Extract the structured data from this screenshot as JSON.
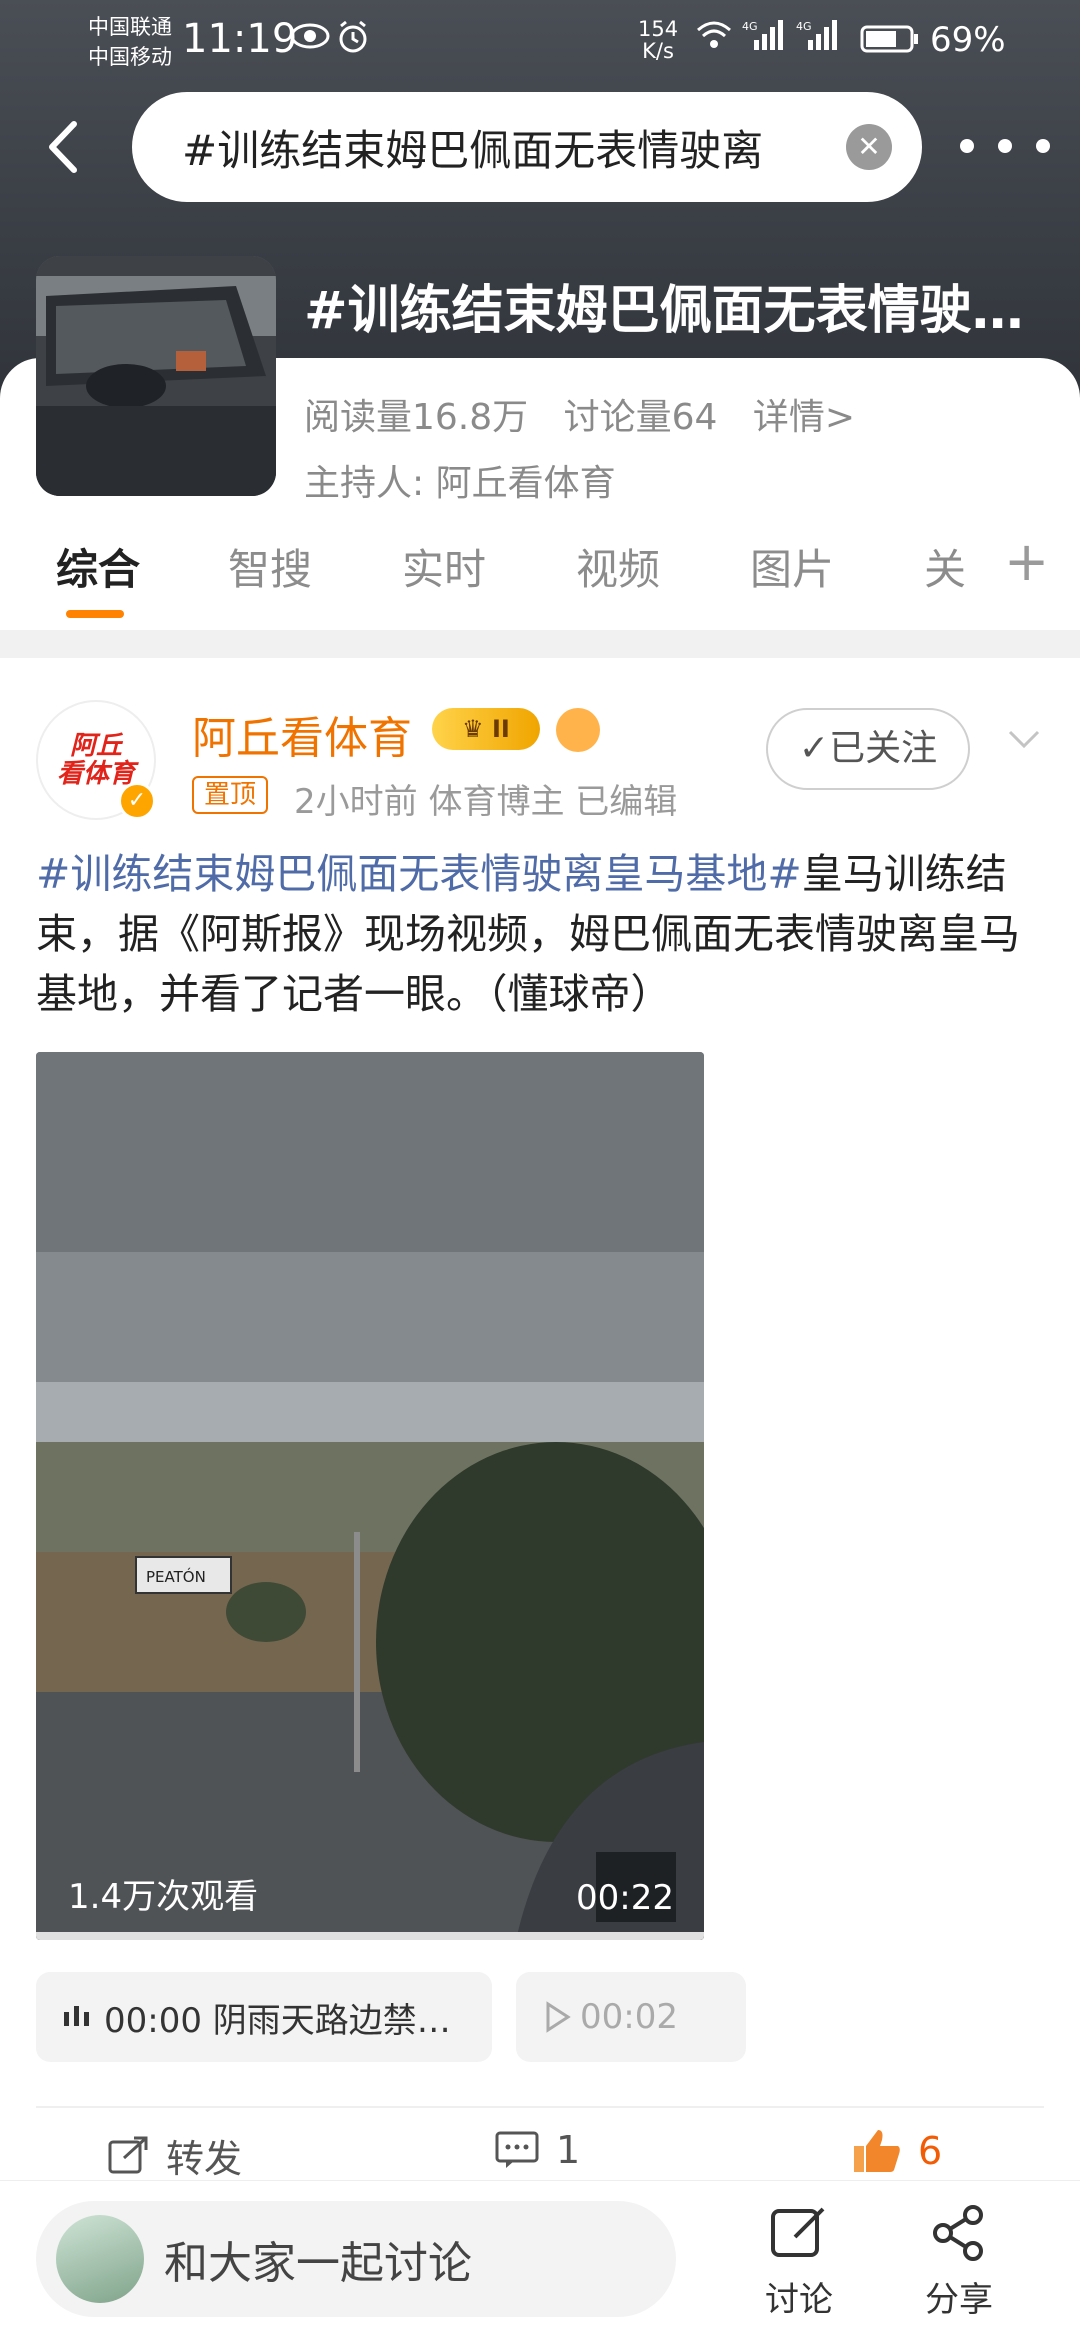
{
  "status_bar": {
    "carrier_1": "中国联通",
    "carrier_2": "中国移动",
    "time": "11:19",
    "net_speed_value": "154",
    "net_speed_unit": "K/s",
    "battery": "69%"
  },
  "search": {
    "query": "#训练结束姆巴佩面无表情驶离"
  },
  "topic": {
    "title": "#训练结束姆巴佩面无表情驶…",
    "reads": "阅读量16.8万",
    "discussions": "讨论量64",
    "details_link": "详情>",
    "host": "主持人: 阿丘看体育"
  },
  "tabs": [
    {
      "label": "综合"
    },
    {
      "label": "智搜"
    },
    {
      "label": "实时"
    },
    {
      "label": "视频"
    },
    {
      "label": "图片"
    },
    {
      "label": "关"
    }
  ],
  "post": {
    "avatar_logo_line1": "阿丘",
    "avatar_logo_line2": "看体育",
    "author": "阿丘看体育",
    "vip_level": "II",
    "pinned_label": "置顶",
    "meta": "2小时前   体育博主   已编辑",
    "follow_label": "✓已关注",
    "hashtag": "#训练结束姆巴佩面无表情驶离皇马基地#",
    "body": "皇马训练结束，据《阿斯报》现场视频，姆巴佩面无表情驶离皇马基地，并看了记者一眼。（懂球帝）",
    "video_views": "1.4万次观看",
    "video_duration": "00:22",
    "video_sign": "PEATÓN",
    "audio_1": "00:00  阴雨天路边禁…",
    "audio_2": "00:02"
  },
  "actions": {
    "repost": "转发",
    "comments": "1",
    "likes": "6"
  },
  "bottom": {
    "discuss_placeholder": "和大家一起讨论",
    "discuss_label": "讨论",
    "share_label": "分享"
  },
  "colors": {
    "accent": "#ff8200",
    "author": "#f07300",
    "hashtag": "#506ca8"
  }
}
